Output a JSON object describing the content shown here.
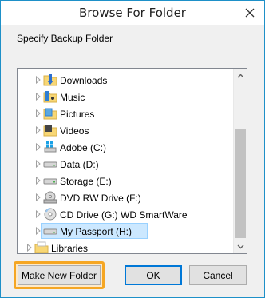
{
  "window": {
    "title": "Browse For Folder"
  },
  "prompt": "Specify Backup Folder",
  "tree": {
    "items": [
      {
        "label": "Downloads",
        "icon": "downloads-folder-icon",
        "expandable": true,
        "selected": false
      },
      {
        "label": "Music",
        "icon": "music-folder-icon",
        "expandable": true,
        "selected": false
      },
      {
        "label": "Pictures",
        "icon": "pictures-folder-icon",
        "expandable": true,
        "selected": false
      },
      {
        "label": "Videos",
        "icon": "videos-folder-icon",
        "expandable": true,
        "selected": false
      },
      {
        "label": "Adobe (C:)",
        "icon": "windows-drive-icon",
        "expandable": true,
        "selected": false
      },
      {
        "label": "Data (D:)",
        "icon": "drive-icon",
        "expandable": true,
        "selected": false
      },
      {
        "label": "Storage (E:)",
        "icon": "drive-icon",
        "expandable": true,
        "selected": false
      },
      {
        "label": "DVD RW Drive (F:)",
        "icon": "dvd-drive-icon",
        "expandable": true,
        "selected": false
      },
      {
        "label": "CD Drive (G:) WD SmartWare",
        "icon": "cd-drive-icon",
        "expandable": true,
        "selected": false
      },
      {
        "label": "My Passport (H:)",
        "icon": "drive-icon",
        "expandable": true,
        "selected": true
      },
      {
        "label": "Libraries",
        "icon": "libraries-icon",
        "expandable": true,
        "selected": false
      }
    ]
  },
  "buttons": {
    "make_new_folder": "Make New Folder",
    "ok": "OK",
    "cancel": "Cancel"
  },
  "colors": {
    "highlight": "#f5a623",
    "selection": "#cce8ff",
    "accent": "#0078d7"
  }
}
